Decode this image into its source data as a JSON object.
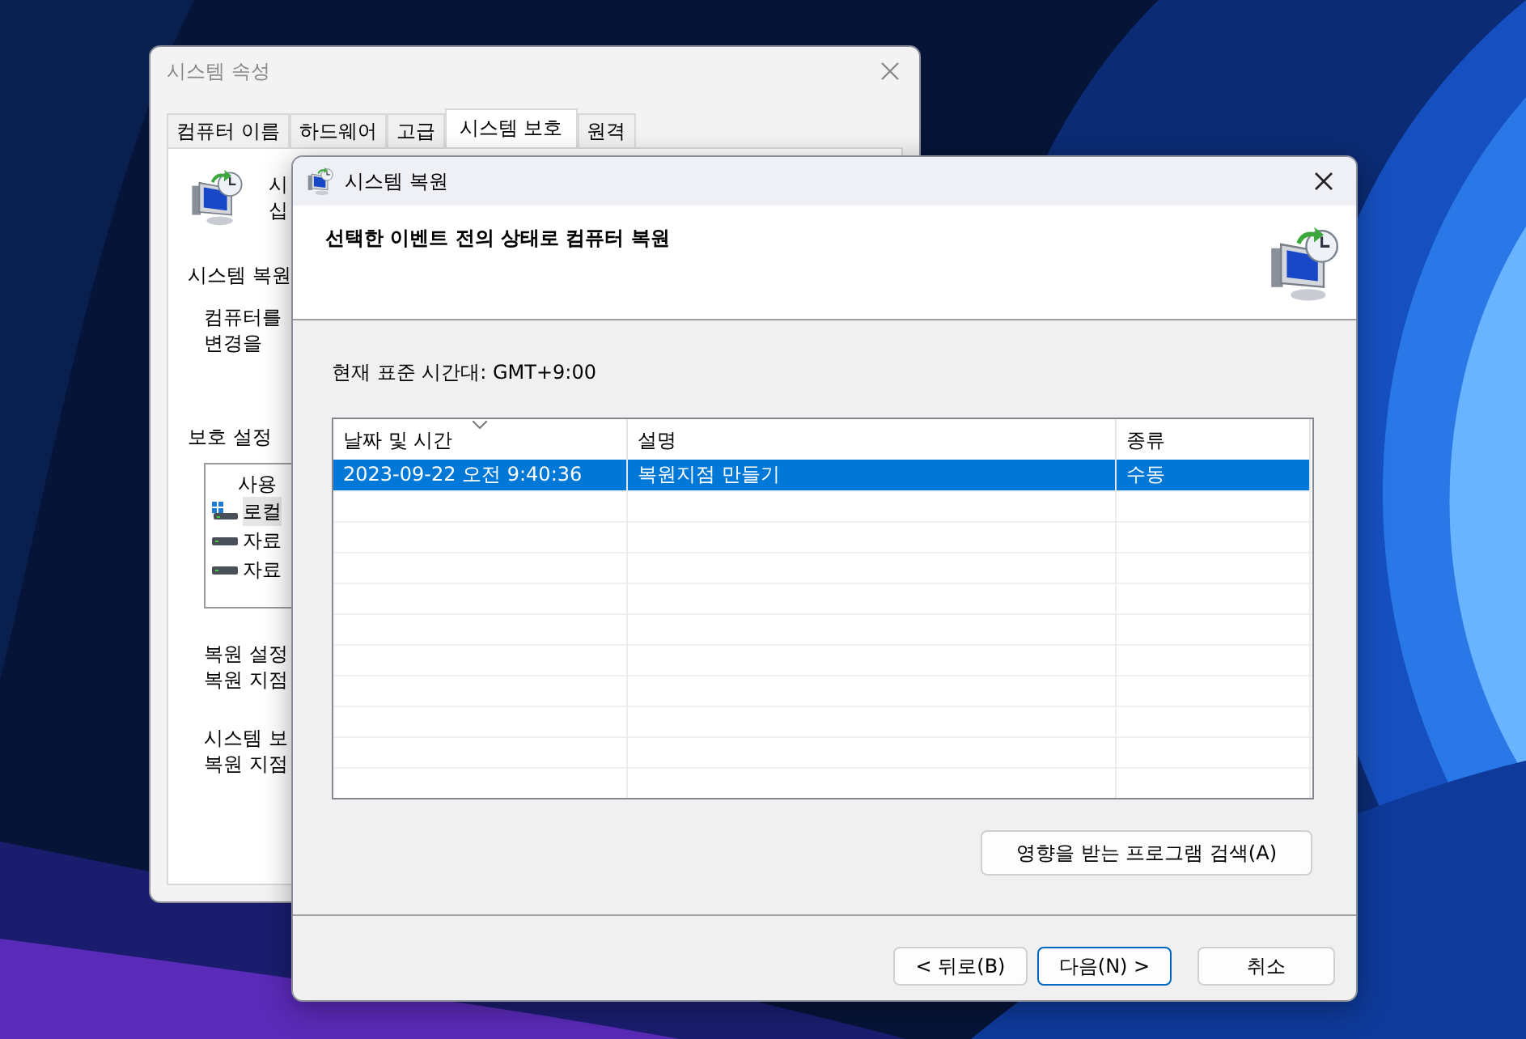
{
  "back_window": {
    "title": "시스템 속성",
    "tabs": [
      {
        "label": "컴퓨터 이름",
        "selected": false
      },
      {
        "label": "하드웨어",
        "selected": false
      },
      {
        "label": "고급",
        "selected": false
      },
      {
        "label": "시스템 보호",
        "selected": true
      },
      {
        "label": "원격",
        "selected": false
      }
    ],
    "intro_lines": [
      "시",
      "십"
    ],
    "restore_heading": "시스템 복원",
    "restore_lines": [
      "컴퓨터를",
      "변경을"
    ],
    "protection_heading": "보호 설정",
    "drives_header": "사용",
    "drives": [
      {
        "label": "로컬",
        "kind": "system",
        "selected": true
      },
      {
        "label": "자료",
        "kind": "data",
        "selected": false
      },
      {
        "label": "자료",
        "kind": "data",
        "selected": false
      }
    ],
    "config_lines": [
      "복원 설정",
      "복원 지점"
    ],
    "create_lines": [
      "시스템 보",
      "복원 지점"
    ]
  },
  "restore_window": {
    "title": "시스템 복원",
    "heading": "선택한 이벤트 전의 상태로 컴퓨터 복원",
    "timezone": "현재 표준 시간대: GMT+9:00",
    "table": {
      "columns": [
        {
          "label": "날짜 및 시간",
          "sorted": true
        },
        {
          "label": "설명",
          "sorted": false
        },
        {
          "label": "종류",
          "sorted": false
        }
      ],
      "rows": [
        {
          "cells": [
            "2023-09-22 오전 9:40:36",
            "복원지점 만들기",
            "수동"
          ],
          "selected": true
        }
      ]
    },
    "scan_button": "영향을 받는 프로그램 검색(A)",
    "buttons": [
      {
        "label": "< 뒤로(B)",
        "default": false
      },
      {
        "label": "다음(N) >",
        "default": true
      },
      {
        "label": "취소",
        "default": false
      }
    ]
  }
}
